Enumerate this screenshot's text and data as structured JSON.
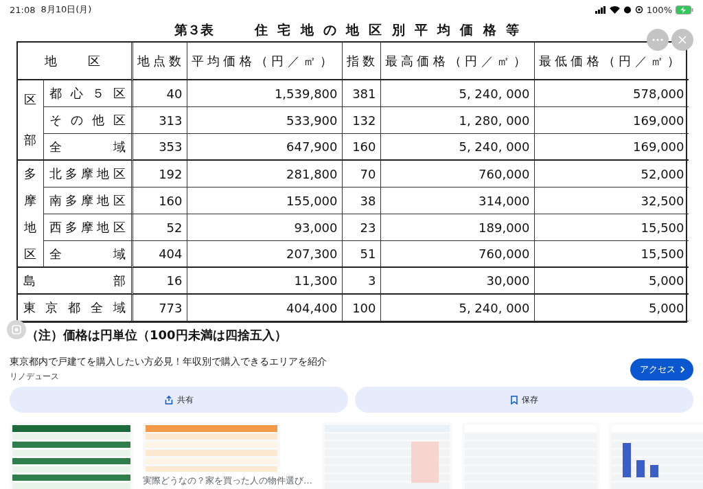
{
  "status_bar": {
    "time": "21:08",
    "date": "8月10日(月)",
    "battery": "100%"
  },
  "document": {
    "title_number": "第３表",
    "title": "住宅地の地区別平均価格等",
    "columns": [
      "地区",
      "地点数",
      "平均価格（円／㎡）",
      "指数",
      "最高価格（円／㎡）",
      "最低価格（円／㎡）"
    ],
    "sections": [
      {
        "kind": "group",
        "label": "区部",
        "rows": [
          {
            "name": "都心５区",
            "points": "40",
            "average": "1,539,800",
            "index": "381",
            "max": "5, 240, 000",
            "min": "578,000"
          },
          {
            "name": "その他区",
            "points": "313",
            "average": "533,900",
            "index": "132",
            "max": "1, 280, 000",
            "min": "169,000"
          },
          {
            "name": "全域",
            "points": "353",
            "average": "647,900",
            "index": "160",
            "max": "5, 240, 000",
            "min": "169,000"
          }
        ]
      },
      {
        "kind": "group",
        "label": "多摩地区",
        "rows": [
          {
            "name": "北多摩地区",
            "points": "192",
            "average": "281,800",
            "index": "70",
            "max": "760,000",
            "min": "52,000"
          },
          {
            "name": "南多摩地区",
            "points": "160",
            "average": "155,000",
            "index": "38",
            "max": "314,000",
            "min": "32,500"
          },
          {
            "name": "西多摩地区",
            "points": "52",
            "average": "93,000",
            "index": "23",
            "max": "189,000",
            "min": "15,500"
          },
          {
            "name": "全域",
            "points": "404",
            "average": "207,300",
            "index": "51",
            "max": "760,000",
            "min": "15,500"
          }
        ]
      },
      {
        "kind": "single",
        "name": "島部",
        "points": "16",
        "average": "11,300",
        "index": "3",
        "max": "30,000",
        "min": "5,000"
      },
      {
        "kind": "single",
        "name": "東京都全域",
        "points": "773",
        "average": "404,400",
        "index": "100",
        "max": "5, 240, 000",
        "min": "5,000"
      }
    ],
    "note": "（注）価格は円単位（100円未満は四捨五入）"
  },
  "result": {
    "title": "東京都内で戸建てを購入したい方必見！年収別で購入できるエリアを紹介",
    "source": "リノデュース",
    "action": "アクセス"
  },
  "actions": [
    "共有",
    "保存"
  ],
  "related": [
    {
      "kind": "picture"
    },
    {
      "kind": "picture",
      "caption": "実際どうなの？家を買った人の物件選び…"
    },
    {
      "kind": "picture"
    },
    {
      "kind": "picture"
    },
    {
      "kind": "picture"
    }
  ]
}
